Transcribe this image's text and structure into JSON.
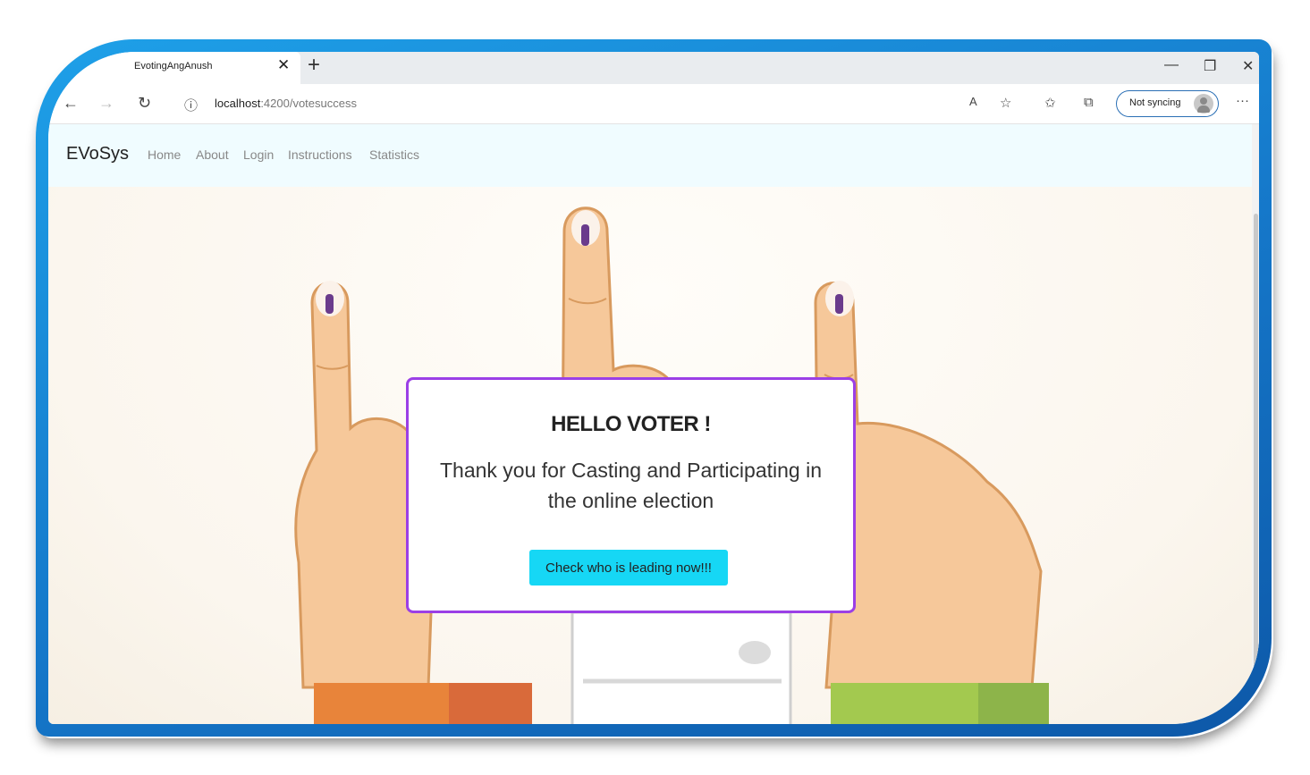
{
  "browser": {
    "tab_title": "EvotingAngAnush",
    "new_tab_label": "+",
    "url_host": "localhost",
    "url_rest": ":4200/votesuccess",
    "sync_label": "Not syncing",
    "more_label": "···"
  },
  "navbar": {
    "brand": "EVoSys",
    "links": [
      "Home",
      "About",
      "Login",
      "Instructions",
      "Statistics"
    ]
  },
  "modal": {
    "heading": "HELLO VOTER !",
    "message": "Thank you for Casting and Participating in the online election",
    "button_label": "Check who is leading now!!!"
  },
  "colors": {
    "frame": "#1577c9",
    "navbar_bg": "#f0fcff",
    "modal_border": "#9b3fe6",
    "button_bg": "#16d7f5",
    "skin": "#f6c89a",
    "ink": "#6a3b8c",
    "saffron_sleeve": "#e8843a",
    "green_sleeve": "#a3c94f"
  }
}
